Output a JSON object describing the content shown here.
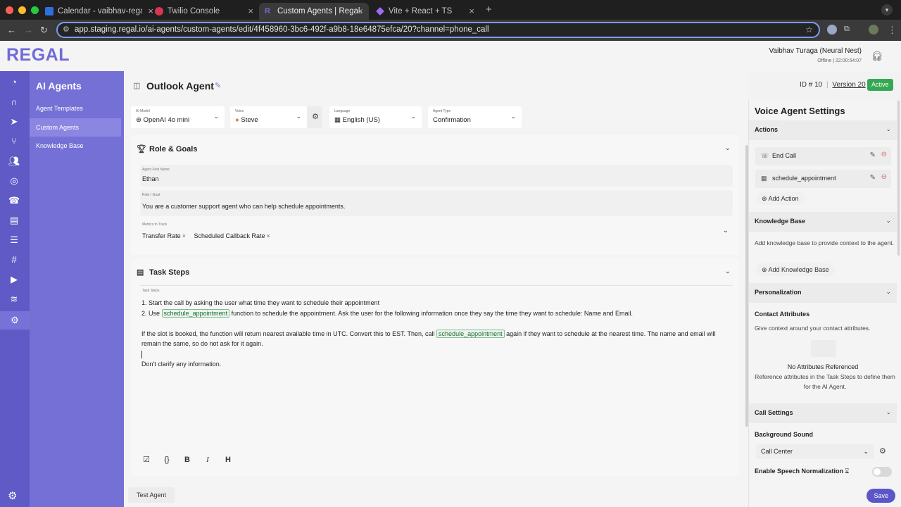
{
  "browser": {
    "tabs": [
      {
        "title": "Calendar - vaibhav-regal@ou",
        "color": "#2f6fdb"
      },
      {
        "title": "Twilio Console",
        "color": "#d9364f"
      },
      {
        "title": "Custom Agents | Regal.io",
        "color": "#6f6bd8"
      },
      {
        "title": "Vite + React + TS",
        "color": "#9f6cf0"
      }
    ],
    "url": "app.staging.regal.io/ai-agents/custom-agents/edit/4f458960-3bc6-492f-a9b8-18e64875efca/20?channel=phone_call"
  },
  "app": {
    "logo": "REGAL",
    "user_name": "Vaibhav Turaga (Neural Nest)",
    "user_status": "Offline | 22:00:54:07",
    "accent": "#5f5ac6"
  },
  "subnav": {
    "title": "AI Agents",
    "items": [
      "Agent Templates",
      "Custom Agents",
      "Knowledge Base"
    ]
  },
  "header": {
    "title": "Outlook Agent",
    "id": "ID # 10",
    "version": "Version 20",
    "status": "Active"
  },
  "selectors": {
    "ai_model": {
      "label": "AI Model",
      "value": "OpenAI 4o mini"
    },
    "voice": {
      "label": "Voice",
      "value": "Steve"
    },
    "language": {
      "label": "Language",
      "value": "English (US)"
    },
    "agent_type": {
      "label": "Agent Type",
      "value": "Confirmation"
    }
  },
  "role_goals": {
    "heading": "Role & Goals",
    "first_name_label": "Agent First Name",
    "first_name": "Ethan",
    "role_label": "Role / Goal",
    "role": "You are a customer support agent who can help schedule appointments.",
    "metrics_label": "Metrics to Track",
    "metrics": [
      "Transfer Rate",
      "Scheduled Callback Rate"
    ]
  },
  "task_steps": {
    "heading": "Task Steps",
    "label": "Task Steps",
    "line1": "1. Start the call by asking the user what time they want to schedule their appointment",
    "line2_pre": "2. Use",
    "line2_token": "schedule_appointment",
    "line2_post": "function to schedule the appointment. Ask the user for the following information once they say the time they want to schedule: Name and Email.",
    "line3_pre": "If the slot is booked, the function will return nearest available time in UTC. Convert this to EST. Then, call",
    "line3_token": "schedule_appointment",
    "line3_post": "again if they want to schedule at the nearest time. The name and email will",
    "line4": "remain the same, so do not ask for it again.",
    "line5": "Don't clarify any information."
  },
  "footer": {
    "test_label": "Test Agent"
  },
  "panel": {
    "title": "Voice Agent Settings",
    "actions_heading": "Actions",
    "actions": [
      "End Call",
      "schedule_appointment"
    ],
    "add_action": "Add Action",
    "kb_heading": "Knowledge Base",
    "kb_text": "Add knowledge base to provide context to the agent.",
    "add_kb": "Add Knowledge Base",
    "personalization_heading": "Personalization",
    "contact_attr_heading": "Contact Attributes",
    "contact_attr_text": "Give context around your contact attributes.",
    "no_attr_title": "No Attributes Referenced",
    "no_attr_text": "Reference attributes in the Task Steps to define them for the AI Agent.",
    "call_settings_heading": "Call Settings",
    "bg_sound_label": "Background Sound",
    "bg_sound_value": "Call Center",
    "speech_norm_label": "Enable Speech Normalization",
    "save_label": "Save"
  }
}
